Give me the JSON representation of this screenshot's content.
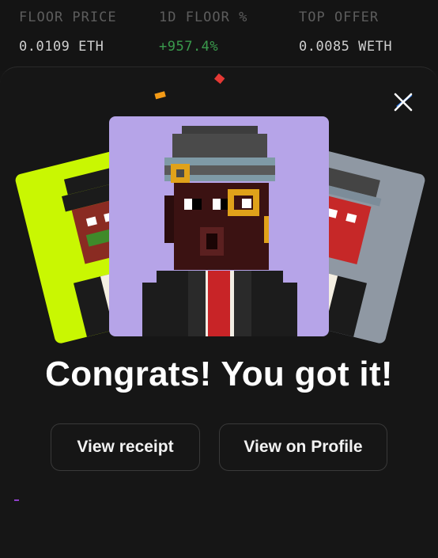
{
  "stats": [
    {
      "label": "FLOOR PRICE",
      "value": "0.0109 ETH"
    },
    {
      "label": "1D FLOOR %",
      "value": "+957.4%"
    },
    {
      "label": "TOP OFFER",
      "value": "0.0085 WETH"
    }
  ],
  "modal": {
    "title": "Congrats! You got it!",
    "view_receipt_label": "View receipt",
    "view_profile_label": "View on Profile",
    "close_icon": "close-icon"
  },
  "colors": {
    "accent_green": "#3a9a4c",
    "card_left_bg": "#c9f702",
    "card_main_bg": "#b6a4e8",
    "card_right_bg": "#8f98a3"
  }
}
